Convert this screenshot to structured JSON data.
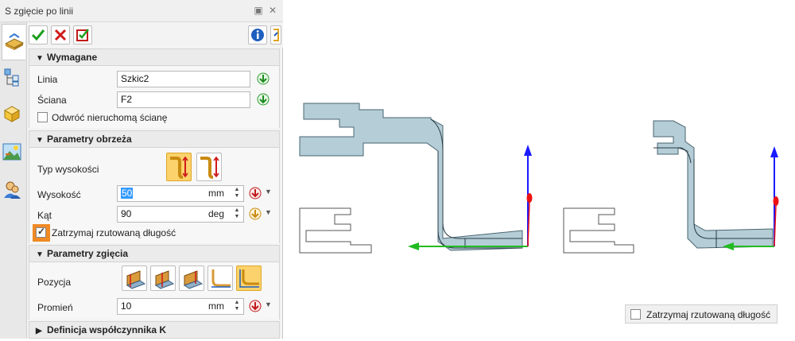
{
  "panel": {
    "title": "S zgięcie po linii",
    "sections": {
      "required": {
        "header": "Wymagane",
        "line_label": "Linia",
        "line_value": "Szkic2",
        "face_label": "Ściana",
        "face_value": "F2",
        "flip_label": "Odwróć nieruchomą ścianę"
      },
      "trim": {
        "header": "Parametry obrzeża",
        "height_type_label": "Typ wysokości",
        "height_label": "Wysokość",
        "height_value": "50",
        "height_unit": "mm",
        "angle_label": "Kąt",
        "angle_value": "90",
        "angle_unit": "deg",
        "keep_label": "Zatrzymaj rzutowaną długość"
      },
      "bend": {
        "header": "Parametry zgięcia",
        "position_label": "Pozycja",
        "radius_label": "Promień",
        "radius_value": "10",
        "radius_unit": "mm"
      },
      "kfactor": {
        "header": "Definicja współczynnika K"
      }
    }
  },
  "viewport": {
    "floating_checkbox_label": "Zatrzymaj rzutowaną długość"
  },
  "colors": {
    "selected": "#fbd26b",
    "highlight_orange": "#f08a24",
    "part_fill": "#b4cdd6",
    "axis_blue": "#1a1aff",
    "axis_green": "#22bb22",
    "axis_red": "#ee1111"
  }
}
